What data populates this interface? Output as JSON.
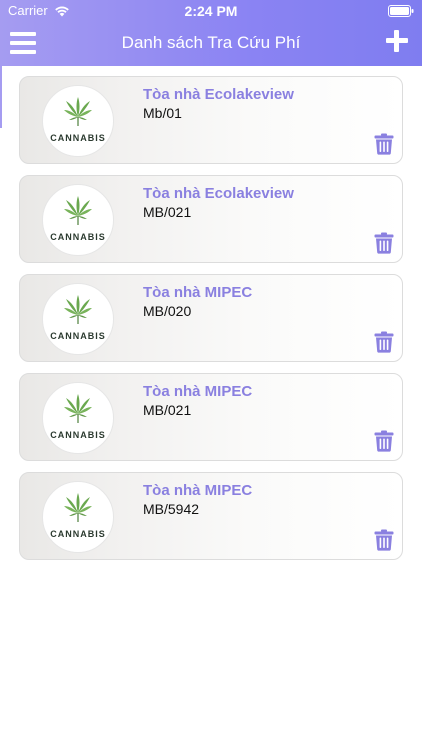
{
  "status_bar": {
    "carrier": "Carrier",
    "time": "2:24 PM"
  },
  "navbar": {
    "title": "Danh sách Tra Cứu Phí"
  },
  "icons": {
    "menu": "hamburger-menu-icon",
    "add": "plus-icon",
    "delete": "trash-icon",
    "logo": "cannabis-leaf-icon"
  },
  "colors": {
    "header_start": "#a59cf1",
    "header_end": "#7f7df0",
    "title_purple": "#8a80e0",
    "trash_purple": "#8a80e0",
    "leaf_green": "#6aa84f"
  },
  "items": [
    {
      "logo_text": "CANNABIS",
      "title": "Tòa nhà Ecolakeview",
      "code": "Mb/01"
    },
    {
      "logo_text": "CANNABIS",
      "title": "Tòa nhà Ecolakeview",
      "code": "MB/021"
    },
    {
      "logo_text": "CANNABIS",
      "title": "Tòa nhà MIPEC",
      "code": "MB/020"
    },
    {
      "logo_text": "CANNABIS",
      "title": "Tòa nhà MIPEC",
      "code": "MB/021"
    },
    {
      "logo_text": "CANNABIS",
      "title": "Tòa nhà MIPEC",
      "code": "MB/5942"
    }
  ]
}
